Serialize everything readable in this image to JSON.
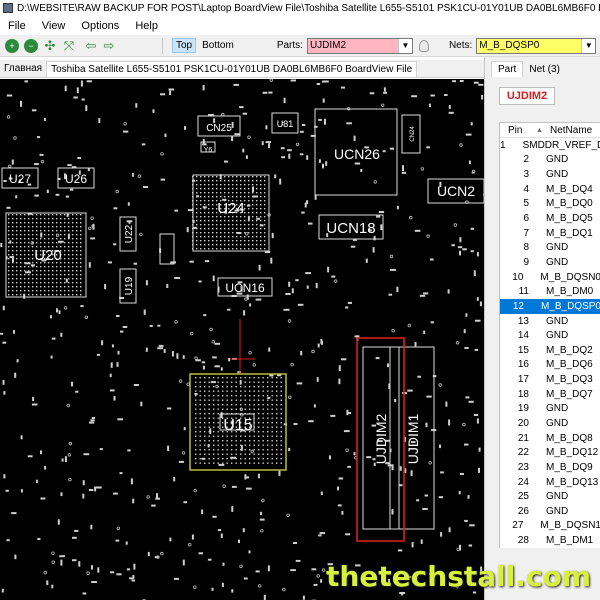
{
  "window": {
    "title": "D:\\WEBSITE\\RAW BACKUP FOR POST\\Laptop BoardView File\\Toshiba Satellite L655-S5101 PSK1CU-01Y01UB DA0BL6MB6F0 BoardView File\\Tosh"
  },
  "menu": {
    "items": [
      {
        "label": "File"
      },
      {
        "label": "View"
      },
      {
        "label": "Options"
      },
      {
        "label": "Help"
      }
    ]
  },
  "toolbar": {
    "layer_top": "Top",
    "layer_bottom": "Bottom",
    "parts_label": "Parts:",
    "parts_value": "UJDIM2",
    "nets_label": "Nets:",
    "nets_value": "M_B_DQSP0",
    "colors": {
      "parts_bg": "#ffb6c1",
      "nets_bg": "#ffff66"
    }
  },
  "tabs": {
    "home": "Главная",
    "file": "Toshiba Satellite L655-S5101 PSK1CU-01Y01UB DA0BL6MB6F0 BoardView File"
  },
  "board": {
    "components": {
      "cn25": "CN25",
      "u31": "U31",
      "ucn26": "UCN26",
      "cn24": "CN24",
      "y6": "Y6",
      "u27": "U27",
      "u26": "U26",
      "u24": "U24",
      "ucn2": "UCN2",
      "ucn18": "UCN18",
      "u20": "U20",
      "u22": "U22",
      "u19": "U19",
      "ucn16": "UCN16",
      "u15": "U15",
      "ujdim2": "UJDIM2",
      "ujdim1": "UJDIM1"
    },
    "colors": {
      "background": "#000000",
      "highlight": "#d42020",
      "selected_part": "#c8c84a"
    }
  },
  "right_panel": {
    "tab_part": "Part",
    "tab_net": "Net (3)",
    "part_name": "UJDIM2",
    "table": {
      "col_pin": "Pin",
      "col_net": "NetName",
      "rows": [
        {
          "pin": "1",
          "net": "SMDDR_VREF_DQ1"
        },
        {
          "pin": "2",
          "net": "GND"
        },
        {
          "pin": "3",
          "net": "GND"
        },
        {
          "pin": "4",
          "net": "M_B_DQ4"
        },
        {
          "pin": "5",
          "net": "M_B_DQ0"
        },
        {
          "pin": "6",
          "net": "M_B_DQ5"
        },
        {
          "pin": "7",
          "net": "M_B_DQ1"
        },
        {
          "pin": "8",
          "net": "GND"
        },
        {
          "pin": "9",
          "net": "GND"
        },
        {
          "pin": "10",
          "net": "M_B_DQSN0"
        },
        {
          "pin": "11",
          "net": "M_B_DM0"
        },
        {
          "pin": "12",
          "net": "M_B_DQSP0",
          "selected": true
        },
        {
          "pin": "13",
          "net": "GND"
        },
        {
          "pin": "14",
          "net": "GND"
        },
        {
          "pin": "15",
          "net": "M_B_DQ2"
        },
        {
          "pin": "16",
          "net": "M_B_DQ6"
        },
        {
          "pin": "17",
          "net": "M_B_DQ3"
        },
        {
          "pin": "18",
          "net": "M_B_DQ7"
        },
        {
          "pin": "19",
          "net": "GND"
        },
        {
          "pin": "20",
          "net": "GND"
        },
        {
          "pin": "21",
          "net": "M_B_DQ8"
        },
        {
          "pin": "22",
          "net": "M_B_DQ12"
        },
        {
          "pin": "23",
          "net": "M_B_DQ9"
        },
        {
          "pin": "24",
          "net": "M_B_DQ13"
        },
        {
          "pin": "25",
          "net": "GND"
        },
        {
          "pin": "26",
          "net": "GND"
        },
        {
          "pin": "27",
          "net": "M_B_DQSN1"
        },
        {
          "pin": "28",
          "net": "M_B_DM1"
        }
      ],
      "selected_color": "#0078d7"
    }
  },
  "watermark": "thetechstall.com"
}
